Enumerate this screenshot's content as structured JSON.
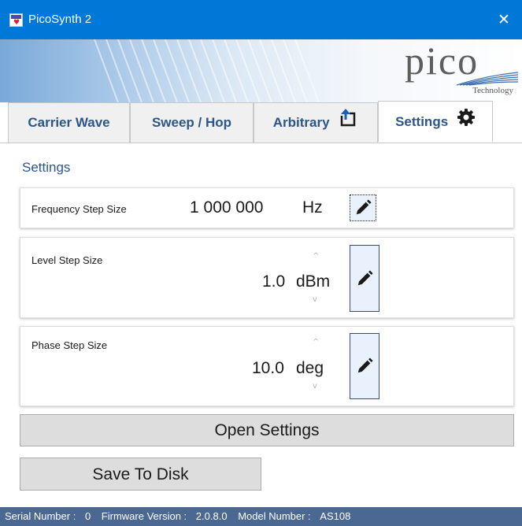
{
  "window": {
    "title": "PicoSynth 2",
    "close_glyph": "✕"
  },
  "banner": {
    "logo_text": "pico",
    "logo_subtext": "Technology"
  },
  "tabs": [
    {
      "label": "Carrier Wave",
      "active": false
    },
    {
      "label": "Sweep / Hop",
      "active": false
    },
    {
      "label": "Arbitrary",
      "active": false,
      "icon": "upload-arrow-icon"
    },
    {
      "label": "Settings",
      "active": true,
      "icon": "gear-icon"
    }
  ],
  "settings": {
    "heading": "Settings",
    "frequency_step": {
      "label": "Frequency Step Size",
      "value": "1 000 000",
      "unit": "Hz",
      "icon": "pencil-icon"
    },
    "level_step": {
      "label": "Level Step Size",
      "value": "1.0",
      "unit": "dBm",
      "spin_up": "^",
      "spin_down": "v",
      "icon": "pencil-icon"
    },
    "phase_step": {
      "label": "Phase Step Size",
      "value": "10.0",
      "unit": "deg",
      "spin_up": "^",
      "spin_down": "v",
      "icon": "pencil-icon"
    }
  },
  "buttons": {
    "open_settings": "Open Settings",
    "save_to_disk": "Save To Disk"
  },
  "status": {
    "serial_label": "Serial Number :",
    "serial_value": "0",
    "firmware_label": "Firmware Version :",
    "firmware_value": "2.0.8.0",
    "model_label": "Model Number :",
    "model_value": "AS108"
  },
  "colors": {
    "titlebar": "#0078d7",
    "tab_text": "#2c5588",
    "statusbar": "#4a6891",
    "edit_button": "#e9f2fc"
  }
}
